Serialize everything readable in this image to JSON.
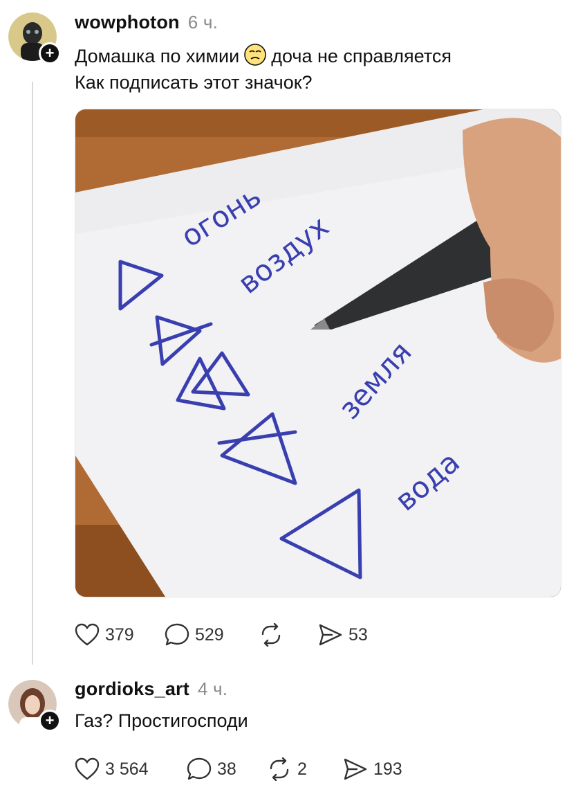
{
  "post": {
    "username": "wowphoton",
    "time": "6 ч.",
    "text_line1a": "Домашка по химии",
    "text_line1b": "доча не справляется",
    "text_line2": "Как подписать этот значок?",
    "image": {
      "labels": [
        "огонь",
        "воздух",
        "земля",
        "вода"
      ]
    },
    "actions": {
      "likes": "379",
      "comments": "529",
      "reposts": "",
      "shares": "53"
    }
  },
  "reply": {
    "username": "gordioks_art",
    "time": "4 ч.",
    "text": "Газ? Простигосподи",
    "actions": {
      "likes": "3 564",
      "comments": "38",
      "reposts": "2",
      "shares": "193"
    }
  },
  "icons": [
    "avatar-icon",
    "plus-icon",
    "emoji-icon",
    "heart-icon",
    "comment-icon",
    "repost-icon",
    "share-icon"
  ],
  "colors": {
    "text": "#111111",
    "muted": "#8a8a8a",
    "ink": "#3a3fb0",
    "thread": "#d9d9d9"
  }
}
